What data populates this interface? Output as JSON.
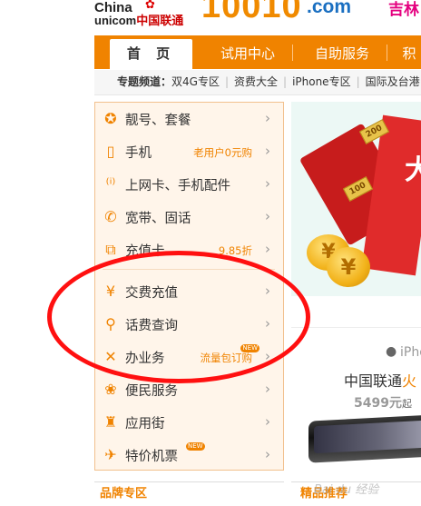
{
  "header": {
    "logo_top": "China",
    "logo_bottom_a": "unicom",
    "logo_bottom_b": "中国联通",
    "site_number": "10010",
    "site_domain": ".com",
    "region": "吉林"
  },
  "nav": {
    "tabs": [
      "首 页",
      "试用中心",
      "自助服务",
      "积"
    ]
  },
  "topics": {
    "label": "专题频道：",
    "items": [
      "双4G专区",
      "资费大全",
      "iPhone专区",
      "国际及台港"
    ]
  },
  "categories": [
    {
      "icon": "coin-icon",
      "label": "靓号、套餐",
      "sub": ""
    },
    {
      "icon": "phone-icon",
      "label": "手机",
      "sub": "老用户0元购"
    },
    {
      "icon": "wireless-icon",
      "label": "上网卡、手机配件",
      "sub": ""
    },
    {
      "icon": "telephone-icon",
      "label": "宽带、固话",
      "sub": ""
    },
    {
      "icon": "recharge-card-icon",
      "label": "充值卡",
      "sub": "9.85折"
    },
    {
      "icon": "yen-icon",
      "label": "交费充值",
      "sub": ""
    },
    {
      "icon": "search-icon",
      "label": "话费查询",
      "sub": ""
    },
    {
      "icon": "tools-icon",
      "label": "办业务",
      "sub": "流量包订购",
      "badge": "NEW"
    },
    {
      "icon": "service-icon",
      "label": "便民服务",
      "sub": ""
    },
    {
      "icon": "android-icon",
      "label": "应用街",
      "sub": ""
    },
    {
      "icon": "airplane-icon",
      "label": "特价机票",
      "sub": "",
      "badge": "NEW"
    }
  ],
  "banner": {
    "coupon_a": "200",
    "coupon_b": "100",
    "headline_char": "大",
    "coin_symbol": "¥"
  },
  "product": {
    "model": "iPho",
    "title_a": "中国联通",
    "title_b": "火",
    "price": "5499元",
    "price_suffix": "起"
  },
  "bottom": {
    "left_heading": "品牌专区",
    "right_heading": "精品推荐"
  },
  "watermark": "Bai du 经验",
  "colors": {
    "accent": "#f08300",
    "annotation": "#ff1010"
  }
}
